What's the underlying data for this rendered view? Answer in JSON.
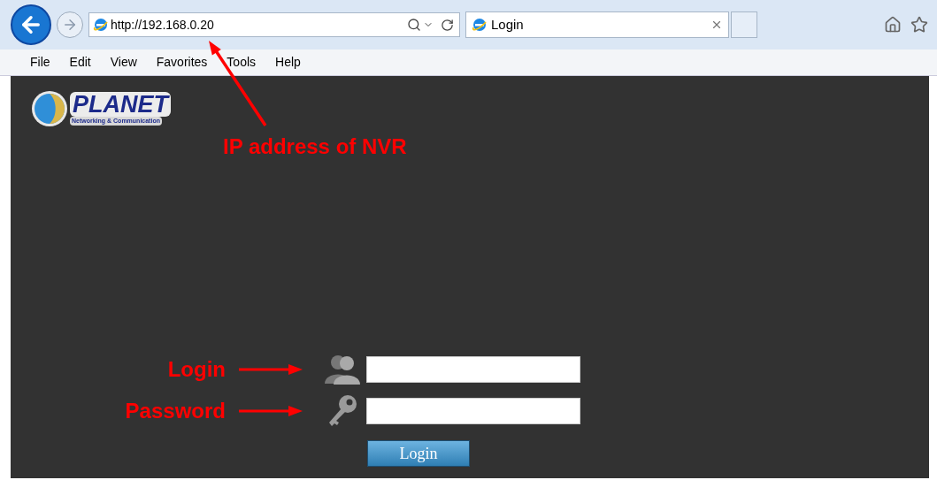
{
  "browser": {
    "address": "http://192.168.0.20",
    "tabs": [
      {
        "title": "Login",
        "selected": true
      }
    ],
    "menu": [
      "File",
      "Edit",
      "View",
      "Favorites",
      "Tools",
      "Help"
    ]
  },
  "page": {
    "logo": {
      "name": "PLANET",
      "tagline": "Networking & Communication"
    },
    "note": "IP address of NVR",
    "fields": [
      {
        "kind": "user",
        "note": "Login"
      },
      {
        "kind": "key",
        "note": "Password"
      }
    ],
    "button": "Login"
  }
}
